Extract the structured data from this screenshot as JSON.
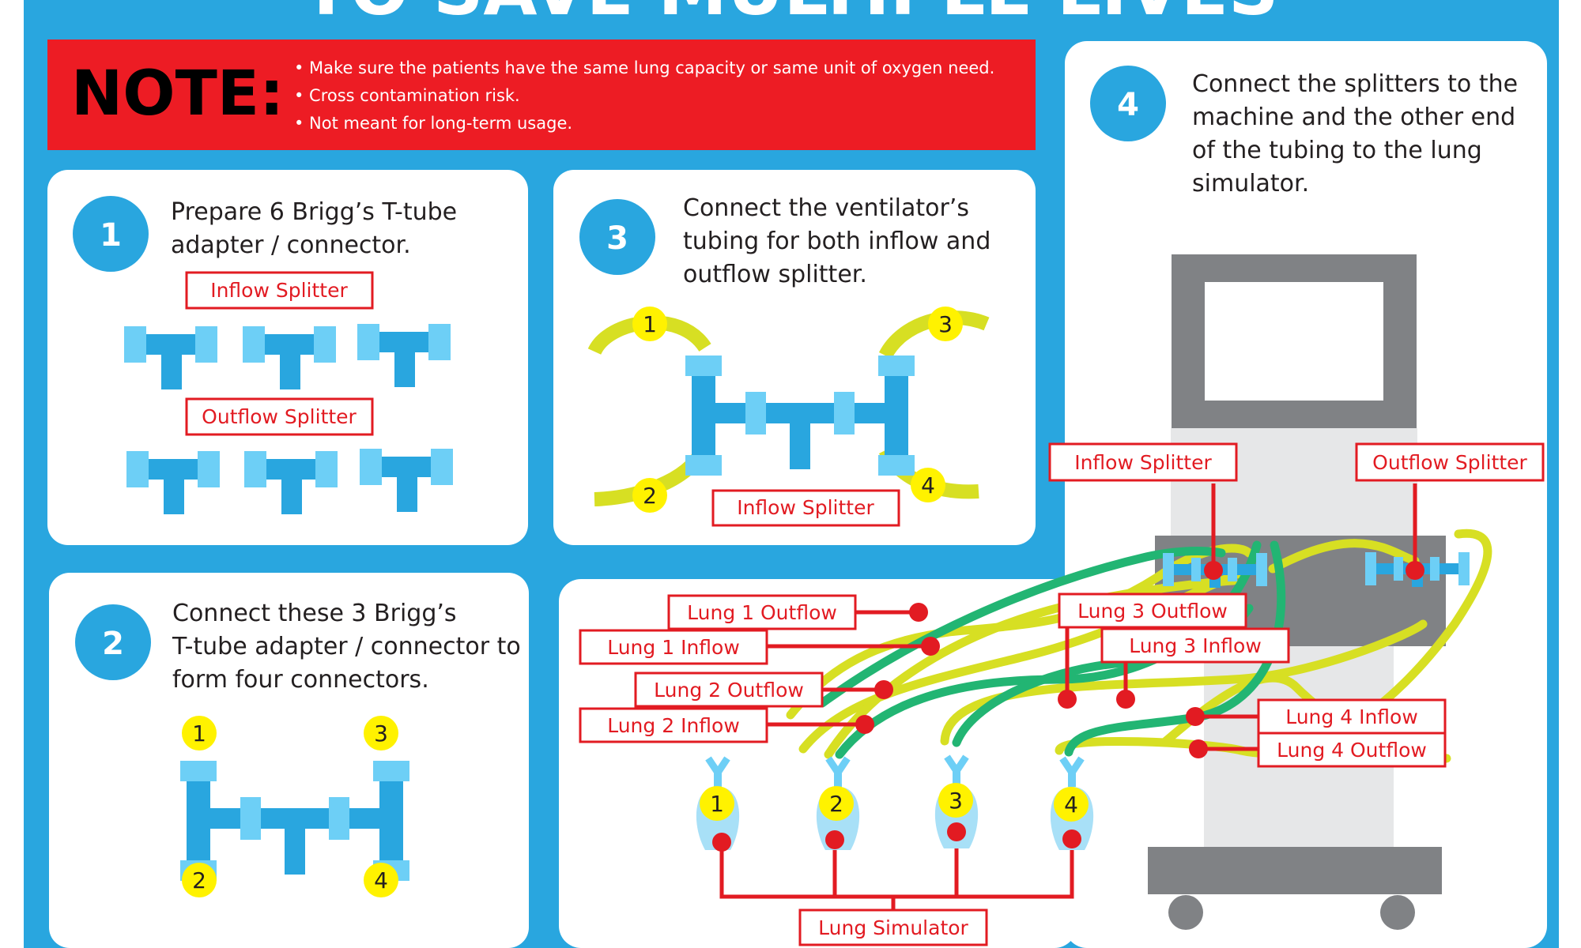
{
  "header": {
    "title": "TO SAVE MULTIPLE LIVES"
  },
  "note": {
    "label": "NOTE:",
    "items": [
      "• Make sure the patients have the same lung capacity or same unit of oxygen need.",
      "• Cross contamination risk.",
      "• Not meant for long-term usage."
    ]
  },
  "steps": [
    {
      "number": "1",
      "lines": [
        "Prepare 6 Brigg’s T-tube",
        "adapter / connector."
      ]
    },
    {
      "number": "2",
      "lines": [
        "Connect these 3 Brigg’s",
        "T-tube adapter / connector to",
        "form four connectors."
      ]
    },
    {
      "number": "3",
      "lines": [
        "Connect the ventilator’s",
        "tubing for both inflow and",
        "outflow splitter."
      ]
    },
    {
      "number": "4",
      "lines": [
        "Connect the splitters to the",
        "machine and the other end",
        "of the tubing to the lung",
        "simulator."
      ]
    }
  ],
  "labels": {
    "inflow_splitter": "Inflow Splitter",
    "outflow_splitter": "Outflow Splitter",
    "lung_1_outflow": "Lung 1 Outflow",
    "lung_1_inflow": "Lung 1 Inflow",
    "lung_2_outflow": "Lung 2 Outflow",
    "lung_2_inflow": "Lung 2 Inflow",
    "lung_3_outflow": "Lung 3 Outflow",
    "lung_3_inflow": "Lung 3 Inflow",
    "lung_4_inflow": "Lung 4 Inflow",
    "lung_4_outflow": "Lung 4 Outflow",
    "lung_simulator": "Lung Simulator"
  },
  "connector_numbers": [
    "1",
    "2",
    "3",
    "4"
  ],
  "colors": {
    "background_blue": "#29a6df",
    "note_red": "#ed1c24",
    "tube_blue": "#29a6df",
    "tube_light_blue": "#6dcff6",
    "tubing_yellow": "#d7df23",
    "tubing_green": "#22b573",
    "marker_yellow": "#fff200",
    "label_red": "#e21b22",
    "machine_gray": "#808285",
    "machine_light": "#e6e7e8"
  }
}
